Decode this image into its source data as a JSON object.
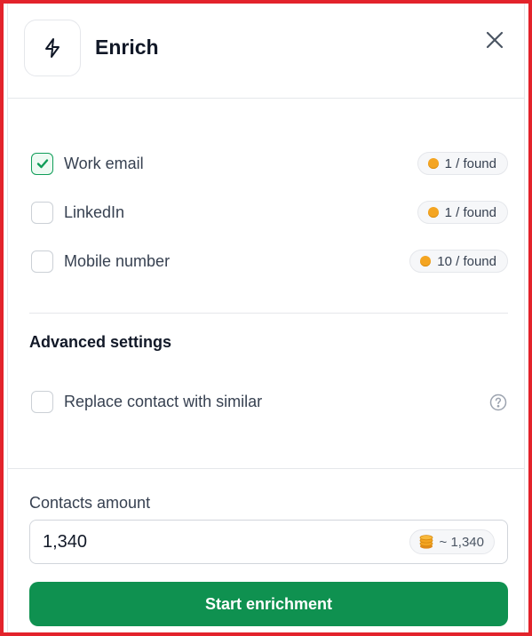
{
  "header": {
    "title": "Enrich",
    "icon": "lightning-icon",
    "close_icon": "close-icon"
  },
  "options": [
    {
      "label": "Work email",
      "checked": true,
      "cost": "1 / found"
    },
    {
      "label": "LinkedIn",
      "checked": false,
      "cost": "1 / found"
    },
    {
      "label": "Mobile number",
      "checked": false,
      "cost": "10 / found"
    }
  ],
  "advanced": {
    "title": "Advanced settings",
    "replace_label": "Replace contact with similar",
    "replace_checked": false,
    "help_icon": "question-circle-icon"
  },
  "footer": {
    "amount_label": "Contacts amount",
    "amount_value": "1,340",
    "estimate": "~ 1,340",
    "estimate_icon": "coins-icon",
    "start_label": "Start enrichment"
  },
  "colors": {
    "accent": "#0f9150",
    "frame": "#e3232b",
    "coin": "#f4a522"
  }
}
